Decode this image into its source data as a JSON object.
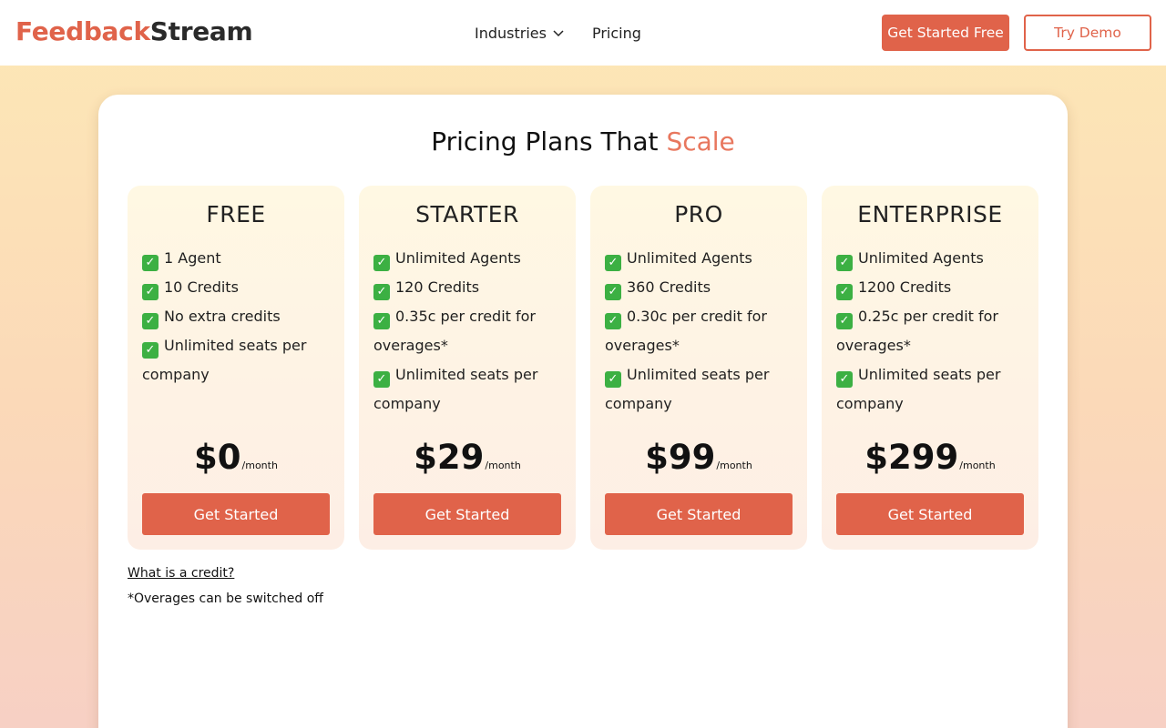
{
  "header": {
    "logo_part1": "Feedback",
    "logo_part2": "Stream",
    "nav": {
      "industries": "Industries",
      "pricing": "Pricing"
    },
    "cta_primary": "Get Started Free",
    "cta_secondary": "Try Demo"
  },
  "main": {
    "title_prefix": "Pricing Plans That ",
    "title_accent": "Scale",
    "plans": [
      {
        "name": "FREE",
        "features": [
          "1 Agent",
          "10 Credits",
          "No extra credits",
          "Unlimited seats per company"
        ],
        "price": "$0",
        "period": "/month",
        "button": "Get Started"
      },
      {
        "name": "STARTER",
        "features": [
          "Unlimited Agents",
          "120 Credits",
          "0.35c per credit for overages*",
          "Unlimited seats per company"
        ],
        "price": "$29",
        "period": "/month",
        "button": "Get Started"
      },
      {
        "name": "PRO",
        "features": [
          "Unlimited Agents",
          "360 Credits",
          "0.30c per credit for overages*",
          "Unlimited seats per company"
        ],
        "price": "$99",
        "period": "/month",
        "button": "Get Started"
      },
      {
        "name": "ENTERPRISE",
        "features": [
          "Unlimited Agents",
          "1200 Credits",
          "0.25c per credit for overages*",
          "Unlimited seats per company"
        ],
        "price": "$299",
        "period": "/month",
        "button": "Get Started"
      }
    ],
    "credit_link": "What is a credit?",
    "footnote": "*Overages can be switched off"
  },
  "icons": {
    "feature_check": "check-mark-icon",
    "nav_dropdown": "chevron-down-icon"
  },
  "colors": {
    "brand": "#e0634a",
    "accent": "#e8775e",
    "check": "#3cb043"
  }
}
